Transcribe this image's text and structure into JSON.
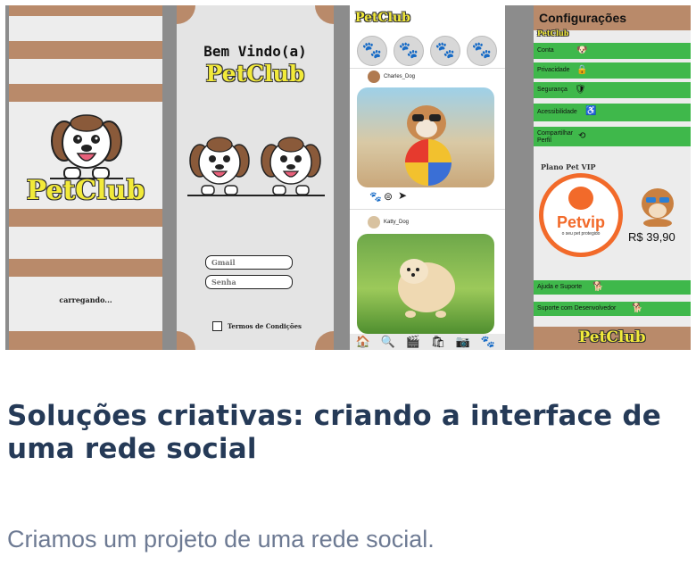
{
  "colors": {
    "brown": "#b98a6a",
    "green": "#3fb84b",
    "yellow": "#f2ea3a",
    "orange": "#f26a2a",
    "headline": "#253a57",
    "subtext": "#6d7a93"
  },
  "splash": {
    "brand": "PetClub",
    "loading": "carregando..."
  },
  "login": {
    "welcome": "Bem Vindo(a)",
    "brand": "PetClub",
    "email_placeholder": "Gmail",
    "password_placeholder": "Senha",
    "terms": "Termos de Condições"
  },
  "feed": {
    "brand": "PetClub",
    "posts": [
      {
        "user": "Charles_Dog"
      },
      {
        "user": "Katty_Dog"
      }
    ],
    "icons": [
      "home-icon",
      "search-icon",
      "video-icon",
      "shop-bag-icon",
      "camera-icon",
      "paw-icon"
    ]
  },
  "settings": {
    "title": "Configurações",
    "brand_small": "PetClub",
    "items": [
      {
        "label": "Conta"
      },
      {
        "label": "Privacidade"
      },
      {
        "label": "Segurança"
      },
      {
        "label": "Acessibilidade"
      },
      {
        "label": "Compartilhar Perfil"
      }
    ],
    "plan_title": "Plano Pet VIP",
    "plan_brand": "Petvip",
    "plan_tagline": "o seu pet protegido",
    "price": "R$ 39,90",
    "support": [
      {
        "label": "Ajuda e Suporte"
      },
      {
        "label": "Suporte com Desenvolvedor"
      }
    ],
    "footer_brand": "PetClub"
  },
  "article": {
    "headline": "Soluções criativas: criando a interface de uma rede social",
    "subtext": "Criamos um projeto de uma rede social."
  }
}
